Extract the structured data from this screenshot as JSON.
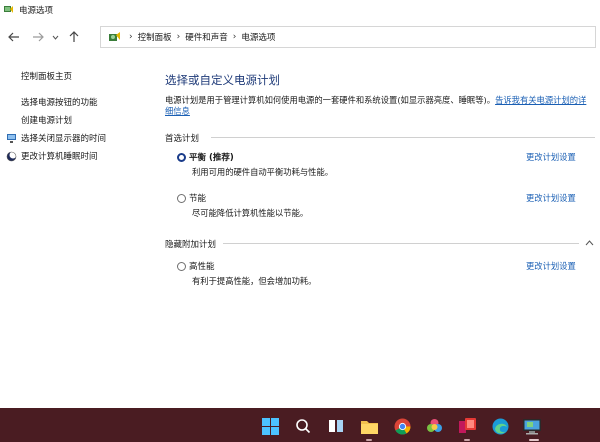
{
  "window": {
    "title": "电源选项"
  },
  "nav": {
    "back_icon": "arrow-left-icon",
    "forward_icon": "arrow-right-icon",
    "recent_icon": "chevron-down-icon",
    "up_icon": "arrow-up-icon"
  },
  "breadcrumb": {
    "items": [
      "控制面板",
      "硬件和声音",
      "电源选项"
    ],
    "separator": "›"
  },
  "sidebar": {
    "home_label": "控制面板主页",
    "items": [
      {
        "label": "选择电源按钮的功能",
        "icon": null
      },
      {
        "label": "创建电源计划",
        "icon": null
      },
      {
        "label": "选择关闭显示器的时间",
        "icon": "monitor-icon"
      },
      {
        "label": "更改计算机睡眠时间",
        "icon": "moon-icon"
      }
    ]
  },
  "main": {
    "heading": "选择或自定义电源计划",
    "description": "电源计划是用于管理计算机如何使用电源的一套硬件和系统设置(如显示器亮度、睡眠等)。",
    "description_link": "告诉我有关电源计划的详细信息",
    "preferred_group": "首选计划",
    "hidden_group": "隐藏附加计划",
    "plans": [
      {
        "name": "平衡 (推荐)",
        "description": "利用可用的硬件自动平衡功耗与性能。",
        "link": "更改计划设置",
        "selected": true
      },
      {
        "name": "节能",
        "description": "尽可能降低计算机性能以节能。",
        "link": "更改计划设置",
        "selected": false
      },
      {
        "name": "高性能",
        "description": "有利于提高性能，但会增加功耗。",
        "link": "更改计划设置",
        "selected": false
      }
    ]
  },
  "colors": {
    "heading": "#1e3a78",
    "link": "#1a5fb4",
    "taskbar": "#4a1c22"
  },
  "taskbar": {
    "icons": [
      "windows-start-icon",
      "search-icon",
      "task-view-icon",
      "file-explorer-icon",
      "chrome-icon",
      "photos-icon",
      "app-icon",
      "edge-icon",
      "control-panel-icon"
    ]
  }
}
